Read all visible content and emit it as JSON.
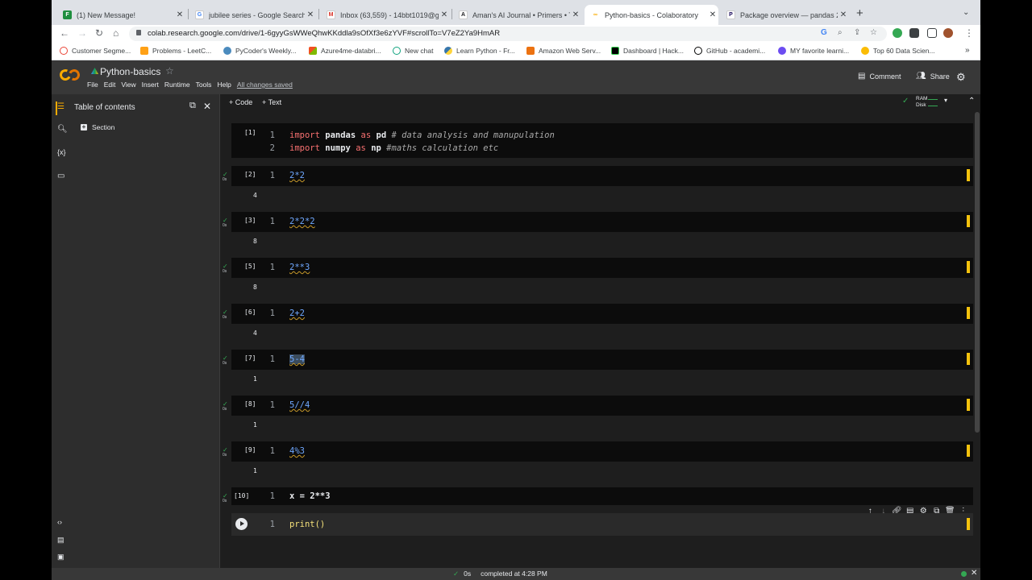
{
  "browser": {
    "tabs": [
      {
        "label": "(1) New Message!",
        "icon": "tab-favicon-icon"
      },
      {
        "label": "jubilee series - Google Search",
        "icon": "google-icon"
      },
      {
        "label": "Inbox (63,559) - 14bbt1019@g",
        "icon": "gmail-icon"
      },
      {
        "label": "Aman's AI Journal • Primers • T",
        "icon": "tab-favicon-icon"
      },
      {
        "label": "Python-basics - Colaboratory",
        "icon": "colab-icon"
      },
      {
        "label": "Package overview — pandas 2.",
        "icon": "pandas-icon"
      }
    ],
    "url": "colab.research.google.com/drive/1-6gyyGsWWeQhwKKddla9sOfXf3e6zYVF#scrollTo=V7eZ2Ya9HmAR",
    "bookmarks": [
      "Customer Segme...",
      "Problems - LeetC...",
      "PyCoder's Weekly...",
      "Azure4me-databri...",
      "New chat",
      "Learn Python - Fr...",
      "Amazon Web Serv...",
      "Dashboard | Hack...",
      "GitHub - academi...",
      "MY favorite learni...",
      "Top 60 Data Scien..."
    ]
  },
  "colab": {
    "title": "Python-basics",
    "menu": [
      "File",
      "Edit",
      "View",
      "Insert",
      "Runtime",
      "Tools",
      "Help"
    ],
    "saved_status": "All changes saved",
    "comment_label": "Comment",
    "share_label": "Share",
    "toc_title": "Table of contents",
    "toc_section": "Section",
    "add_code": "+ Code",
    "add_text": "+ Text",
    "ram_label": "RAM",
    "disk_label": "Disk",
    "run_status_time": "0s"
  },
  "cells": [
    {
      "exec": "[1]",
      "lines": [
        "1",
        "2"
      ],
      "output": ""
    },
    {
      "exec": "[2]",
      "code": "2*2",
      "output": "4"
    },
    {
      "exec": "[3]",
      "code": "2*2*2",
      "output": "8"
    },
    {
      "exec": "[5]",
      "code": "2**3",
      "output": "8"
    },
    {
      "exec": "[6]",
      "code": "2+2",
      "output": "4"
    },
    {
      "exec": "[7]",
      "code": "5-4",
      "output": "1"
    },
    {
      "exec": "[8]",
      "code": "5//4",
      "output": "1"
    },
    {
      "exec": "[9]",
      "code": "4%3",
      "output": "1"
    },
    {
      "exec": "[10]",
      "code": "x = 2**3",
      "output": ""
    },
    {
      "exec": "",
      "code": "print()",
      "output": ""
    }
  ],
  "cell1": {
    "l1_kw1": "import",
    "l1_mod": "pandas",
    "l1_kw2": "as",
    "l1_alias": "pd",
    "l1_comment": "# data analysis and manupulation",
    "l2_kw1": "import",
    "l2_mod": "numpy",
    "l2_kw2": "as",
    "l2_alias": "np",
    "l2_comment": "#maths calculation etc"
  },
  "status": {
    "check": "✓",
    "time": "0s",
    "text": "completed at 4:28 PM"
  },
  "colors": {
    "accent": "#f9ab00",
    "success": "#34a853",
    "keyword": "#f97171",
    "number": "#6fa8ff"
  }
}
